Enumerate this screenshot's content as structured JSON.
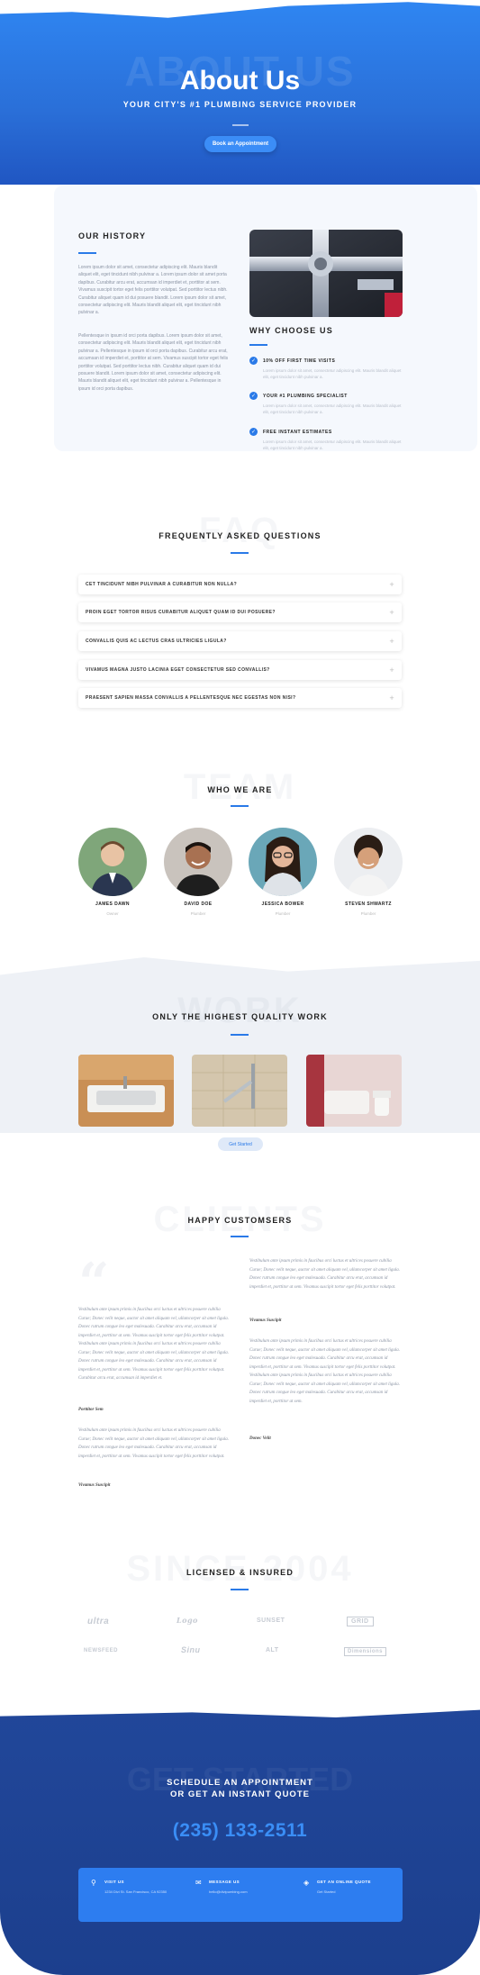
{
  "hero": {
    "ghost": "ABOUT US",
    "title": "About Us",
    "subtitle": "YOUR CITY'S #1 PLUMBING SERVICE PROVIDER",
    "button": "Book an Appointment"
  },
  "history": {
    "title": "OUR HISTORY",
    "p1": "Lorem ipsum dolor sit amet, consectetur adipiscing elit. Mauris blandit aliquet elit, eget tincidunt nibh pulvinar a. Lorem ipsum dolor sit amet porta dapibus. Curabitur arcu erat, accumsan id imperdiet et, porttitor at sem. Vivamus suscipit tortor eget felis porttitor volutpat. Sed porttitor lectus nibh. Curabitur aliquet quam id dui posuere blandit. Lorem ipsum dolor sit amet, consectetur adipiscing elit. Mauris blandit aliquet elit, eget tincidunt nibh pulvinar a.",
    "p2": "Pellentesque in ipsum id orci porta dapibus. Lorem ipsum dolor sit amet, consectetur adipiscing elit. Mauris blandit aliquet elit, eget tincidunt nibh pulvinar a. Pellentesque in ipsum id orci porta dapibus. Curabitur arcu erat, accumsan id imperdiet et, porttitor at sem. Vivamus suscipit tortor eget felis porttitor volutpat. Sed porttitor lectus nibh. Curabitur aliquet quam id dui posuere blandit. Lorem ipsum dolor sit amet, consectetur adipiscing elit. Mauris blandit aliquet elit, eget tincidunt nibh pulvinar a. Pellentesque in ipsum id orci porta dapibus."
  },
  "why": {
    "title": "WHY CHOOSE US",
    "items": [
      {
        "title": "10% OFF FIRST TIME VISITS",
        "text": "Lorem ipsum dolor sit amet, consectetur adipiscing elit. Mauris blandit aliquet elit, eget tincidunt nibh pulvinar a."
      },
      {
        "title": "YOUR #1 PLUMBING SPECIALIST",
        "text": "Lorem ipsum dolor sit amet, consectetur adipiscing elit. Mauris blandit aliquet elit, eget tincidunt nibh pulvinar a."
      },
      {
        "title": "FREE INSTANT ESTIMATES",
        "text": "Lorem ipsum dolor sit amet, consectetur adipiscing elit. Mauris blandit aliquet elit, eget tincidunt nibh pulvinar a."
      }
    ]
  },
  "faq": {
    "ghost": "FAQ",
    "title": "FREQUENTLY ASKED QUESTIONS",
    "items": [
      "CET TINCIDUNT NIBH PULVINAR A CURABITUR NON NULLA?",
      "PROIN EGET TORTOR RISUS CURABITUR ALIQUET QUAM ID DUI POSUERE?",
      "CONVALLIS QUIS AC LECTUS CRAS ULTRICIES LIGULA?",
      "VIVAMUS MAGNA JUSTO LACINIA EGET CONSECTETUR SED CONVALLIS?",
      "PRAESENT SAPIEN MASSA CONVALLIS A PELLENTESQUE NEC EGESTAS NON NISI?"
    ],
    "toggle_icon": "+"
  },
  "team": {
    "ghost": "TEAM",
    "title": "WHO WE ARE",
    "members": [
      {
        "name": "JAMES DAWN",
        "role": "Owner"
      },
      {
        "name": "DAVID DOE",
        "role": "Plumber"
      },
      {
        "name": "JESSICA BOWER",
        "role": "Plumber"
      },
      {
        "name": "STEVEN SHWARTZ",
        "role": "Plumber"
      }
    ]
  },
  "work": {
    "ghost": "WORK",
    "title": "ONLY THE HIGHEST QUALITY WORK",
    "button": "Get Started"
  },
  "clients": {
    "ghost": "CLIENTS",
    "title": "HAPPY CUSTOMSERS",
    "left": [
      {
        "text": "Vestibulum ante ipsum primis in faucibus orci luctus et ultrices posuere cubilia Curae; Donec velit neque, auctor sit amet aliquam vel, ullamcorper sit amet ligula. Donec rutrum congue leo eget malesuada. Curabitur arcu erat, accumsan id imperdiet et, porttitor at sem. Vivamus suscipit tortor eget felis porttitor volutpat. Vestibulum ante ipsum primis in faucibus orci luctus et ultrices posuere cubilia Curae; Donec velit neque, auctor sit amet aliquam vel, ullamcorper sit amet ligula. Donec rutrum congue leo eget malesuada. Curabitur arcu erat, accumsan id imperdiet et, porttitor at sem. Vivamus suscipit tortor eget felis porttitor volutpat. Curabitur arcu erat, accumsan id imperdiet et.",
        "author": "Porttitor Sem"
      },
      {
        "text": "Vestibulum ante ipsum primis in faucibus orci luctus et ultrices posuere cubilia Curae; Donec velit neque, auctor sit amet aliquam vel, ullamcorper sit amet ligula. Donec rutrum congue leo eget malesuada. Curabitur arcu erat, accumsan id imperdiet et, porttitor at sem. Vivamus suscipit tortor eget felis porttitor volutpat.",
        "author": "Vivamus Suscipit"
      }
    ],
    "right": [
      {
        "text": "Vestibulum ante ipsum primis in faucibus orci luctus et ultrices posuere cubilia Curae; Donec velit neque, auctor sit amet aliquam vel, ullamcorper sit amet ligula. Donec rutrum congue leo eget malesuada. Curabitur arcu erat, accumsan id imperdiet et, porttitor at sem. Vivamus suscipit tortor eget felis porttitor volutpat.",
        "author": "Vivamus Suscipit"
      },
      {
        "text": "Vestibulum ante ipsum primis in faucibus orci luctus et ultrices posuere cubilia Curae; Donec velit neque, auctor sit amet aliquam vel, ullamcorper sit amet ligula. Donec rutrum congue leo eget malesuada. Curabitur arcu erat, accumsan id imperdiet et, porttitor at sem. Vivamus suscipit tortor eget felis porttitor volutpat. Vestibulum ante ipsum primis in faucibus orci luctus et ultrices posuere cubilia Curae; Donec velit neque, auctor sit amet aliquam vel, ullamcorper sit amet ligula. Donec rutrum congue leo eget malesuada. Curabitur arcu erat, accumsan id imperdiet et, porttitor at sem.",
        "author": "Donec Velit"
      }
    ]
  },
  "licensed": {
    "ghost": "SINCE 2004",
    "title": "LICENSED & INSURED",
    "logos": [
      "ultra",
      "Logo",
      "SUNSET",
      "GRID",
      "NEWSFEED",
      "Sinu",
      "ALT",
      "Dimensions"
    ]
  },
  "footer": {
    "ghost": "GET STARTED",
    "cta_line1": "SCHEDULE AN APPOINTMENT",
    "cta_line2": "OR GET AN INSTANT QUOTE",
    "phone": "(235) 133-2511",
    "contacts": [
      {
        "title": "VISIT US",
        "text": "1234 Divi St. San Francisco, CA 92350",
        "icon": "map-pin-icon"
      },
      {
        "title": "MESSAGE US",
        "text": "hello@divipumbing.com",
        "icon": "envelope-icon"
      },
      {
        "title": "GET AN ONLINE QUOTE",
        "text": "Get Started",
        "icon": "tag-icon"
      }
    ]
  },
  "colors": {
    "primary": "#2a7ae8",
    "footer": "#1f4493",
    "accent_phone": "#3a8ef6"
  }
}
